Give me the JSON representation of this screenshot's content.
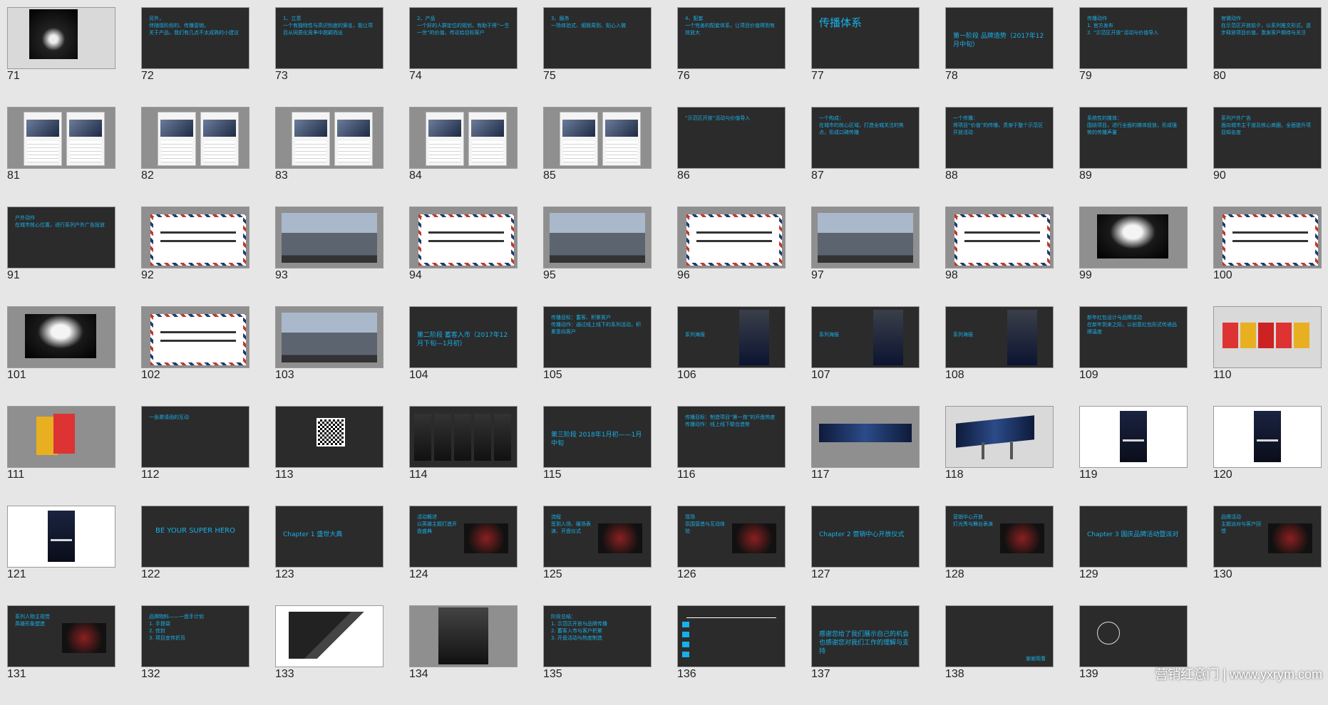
{
  "watermark": "营销红意门 | www.yxrym.com",
  "slides": [
    {
      "n": "71",
      "bg": "lightgray",
      "kind": "photo-box"
    },
    {
      "n": "72",
      "bg": "dark",
      "text": "另外，\n伴随现阶段的、传播营销，\n关于产品，我们有几点不太成熟的小建议"
    },
    {
      "n": "73",
      "bg": "dark",
      "text": "1、立意\n一个有独特性与高识别度的案名，能让项目从同质化竞争中脱颖而出"
    },
    {
      "n": "74",
      "bg": "dark",
      "text": "2、产品\n一个好的人群定位的规划，有助于将“一生一世”的价值，传达给目标客户"
    },
    {
      "n": "75",
      "bg": "dark",
      "text": "3、服务\n一场体验式、细致周到、贴心入微"
    },
    {
      "n": "76",
      "bg": "dark",
      "text": "4、配套\n一个完善的配套体系，让项目价值得到有效放大"
    },
    {
      "n": "77",
      "bg": "dark",
      "text": "传播体系",
      "big": true
    },
    {
      "n": "78",
      "bg": "dark",
      "text": "第一阶段 品牌造势（2017年12月中旬）",
      "mid": true
    },
    {
      "n": "79",
      "bg": "dark",
      "text": "传播动作\n1. 官方发布\n2. “示范区开放”活动与价值导入"
    },
    {
      "n": "80",
      "bg": "dark",
      "text": "官微动作\n在示范区开放前夕，以系列推文形式，逐步释放项目价值，激发客户期待与关注"
    },
    {
      "n": "81",
      "bg": "gray",
      "kind": "phones2"
    },
    {
      "n": "82",
      "bg": "gray",
      "kind": "phones2"
    },
    {
      "n": "83",
      "bg": "gray",
      "kind": "phones2"
    },
    {
      "n": "84",
      "bg": "gray",
      "kind": "phones2"
    },
    {
      "n": "85",
      "bg": "gray",
      "kind": "phones2"
    },
    {
      "n": "86",
      "bg": "dark",
      "text": "“示范区开放”活动与价值导入"
    },
    {
      "n": "87",
      "bg": "dark",
      "text": "一个构成：\n在城市的核心区域，打造全城关注的焦点，形成口碑传播"
    },
    {
      "n": "88",
      "bg": "dark",
      "text": "一个传播：\n将项目“价值”的传播，贯穿于整个示范区开放活动"
    },
    {
      "n": "89",
      "bg": "dark",
      "text": "系统性的媒体：\n围绕项目，进行全面的媒体投放，形成强势的传播声量"
    },
    {
      "n": "90",
      "bg": "dark",
      "text": "系列户外广告\n面向城市主干道及核心商圈，全面提升项目知名度"
    },
    {
      "n": "91",
      "bg": "dark",
      "text": "户外动作\n在城市核心位置，进行系列户外广告投放"
    },
    {
      "n": "92",
      "bg": "gray",
      "kind": "letter"
    },
    {
      "n": "93",
      "bg": "gray",
      "kind": "building"
    },
    {
      "n": "94",
      "bg": "gray",
      "kind": "letter"
    },
    {
      "n": "95",
      "bg": "gray",
      "kind": "building"
    },
    {
      "n": "96",
      "bg": "gray",
      "kind": "letter"
    },
    {
      "n": "97",
      "bg": "gray",
      "kind": "building"
    },
    {
      "n": "98",
      "bg": "gray",
      "kind": "letter"
    },
    {
      "n": "99",
      "bg": "gray",
      "kind": "night"
    },
    {
      "n": "100",
      "bg": "gray",
      "kind": "letter"
    },
    {
      "n": "101",
      "bg": "gray",
      "kind": "night"
    },
    {
      "n": "102",
      "bg": "gray",
      "kind": "letter"
    },
    {
      "n": "103",
      "bg": "gray",
      "kind": "building"
    },
    {
      "n": "104",
      "bg": "dark",
      "text": "第二阶段 蓄客入市（2017年12月下旬—1月初）",
      "mid": true
    },
    {
      "n": "105",
      "bg": "dark",
      "text": "传播目标：蓄客、积累客户\n传播动作：通过线上线下的系列活动，积累意向客户"
    },
    {
      "n": "106",
      "bg": "dark",
      "kind": "poster-side",
      "text": "系列海报"
    },
    {
      "n": "107",
      "bg": "dark",
      "kind": "poster-side",
      "text": "系列海报"
    },
    {
      "n": "108",
      "bg": "dark",
      "kind": "poster-side",
      "text": "系列海报"
    },
    {
      "n": "109",
      "bg": "dark",
      "text": "新年红包设计与品牌活动\n在新年到来之际，以创意红包形式传递品牌温度"
    },
    {
      "n": "110",
      "bg": "lightgray",
      "kind": "envelopes"
    },
    {
      "n": "111",
      "bg": "gray",
      "kind": "envelopes2"
    },
    {
      "n": "112",
      "bg": "dark",
      "text": "一张邀请函的互动"
    },
    {
      "n": "113",
      "bg": "dark",
      "kind": "qr"
    },
    {
      "n": "114",
      "bg": "dark",
      "kind": "phones5"
    },
    {
      "n": "115",
      "bg": "dark",
      "text": "第三阶段 2018年1月初——1月中旬",
      "mid": true
    },
    {
      "n": "116",
      "bg": "dark",
      "text": "传播目标：制造项目“第一炮”的开盘热度\n传播动作：线上线下联合造势"
    },
    {
      "n": "117",
      "bg": "gray",
      "kind": "banner"
    },
    {
      "n": "118",
      "bg": "lightgray",
      "kind": "billboard"
    },
    {
      "n": "119",
      "bg": "white",
      "kind": "poster-center"
    },
    {
      "n": "120",
      "bg": "white",
      "kind": "poster-center"
    },
    {
      "n": "121",
      "bg": "white",
      "kind": "poster-center"
    },
    {
      "n": "122",
      "bg": "dark",
      "text": "BE YOUR SUPER HERO",
      "center": true
    },
    {
      "n": "123",
      "bg": "dark",
      "text": "Chapter 1  盛世大典",
      "mid": true
    },
    {
      "n": "124",
      "bg": "dark",
      "kind": "text-photo",
      "text": "活动概述\n以英雄主题打造开盘盛典"
    },
    {
      "n": "125",
      "bg": "dark",
      "kind": "text-photo",
      "text": "流程\n签到入场、暖场表演、开盘仪式"
    },
    {
      "n": "126",
      "bg": "dark",
      "kind": "text-photo",
      "text": "现场\n氛围营造与互动体验"
    },
    {
      "n": "127",
      "bg": "dark",
      "text": "Chapter 2  营销中心开放仪式",
      "mid": true
    },
    {
      "n": "128",
      "bg": "dark",
      "kind": "text-photo",
      "text": "营销中心开放\n灯光秀与舞台表演"
    },
    {
      "n": "129",
      "bg": "dark",
      "text": "Chapter 3  国庆品牌活动暨派对",
      "mid": true
    },
    {
      "n": "130",
      "bg": "dark",
      "kind": "text-photo",
      "text": "品牌活动\n主题派对与客户回馈"
    },
    {
      "n": "131",
      "bg": "dark",
      "kind": "text-photo",
      "text": "系列人物主视觉\n英雄形象塑造"
    },
    {
      "n": "132",
      "bg": "dark",
      "text": "品牌物料——一盘手计划\n1. 手提袋\n2. 信封\n3. 项目宣传折页"
    },
    {
      "n": "133",
      "bg": "white",
      "kind": "stationery"
    },
    {
      "n": "134",
      "bg": "gray",
      "kind": "dark-box"
    },
    {
      "n": "135",
      "bg": "dark",
      "text": "阶段总结：\n1. 示范区开放与品牌传播\n2. 蓄客入市与客户积累\n3. 开盘活动与热度制造"
    },
    {
      "n": "136",
      "bg": "dark",
      "kind": "timeline"
    },
    {
      "n": "137",
      "bg": "dark",
      "text": "感谢您给了我们展示自己的机会\n也感谢您对我们工作的理解与支持",
      "mid": true
    },
    {
      "n": "138",
      "bg": "dark",
      "text": "谢谢观看",
      "bottomright": true
    },
    {
      "n": "139",
      "bg": "dark",
      "kind": "logo"
    }
  ]
}
